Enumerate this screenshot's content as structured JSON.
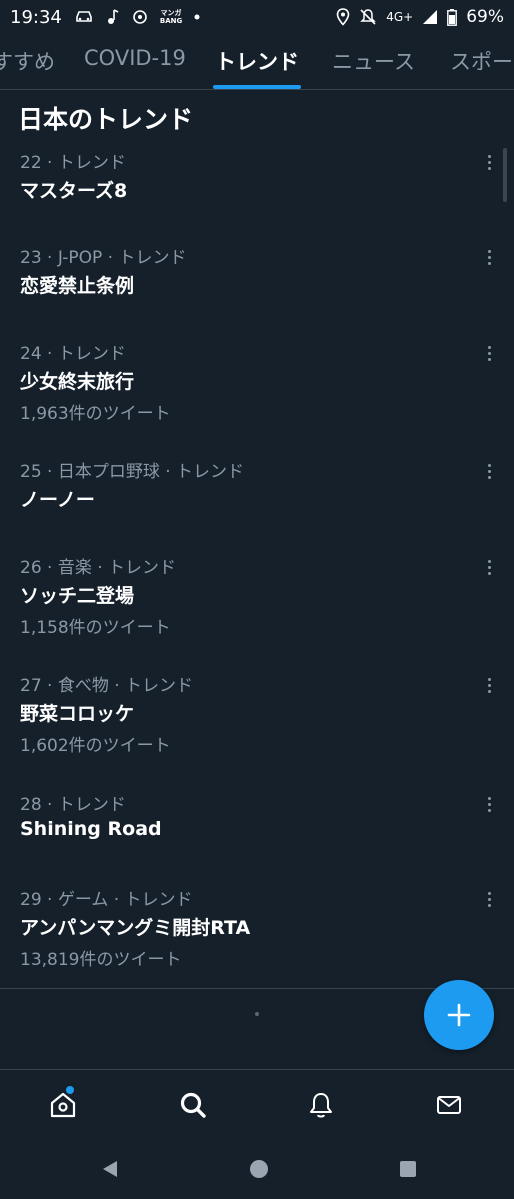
{
  "status_bar": {
    "time": "19:34",
    "network": "4G+",
    "battery": "69%",
    "icons": [
      "car-icon",
      "music-note-icon",
      "app-icon",
      "manga-bang-icon",
      "dot-icon",
      "location-icon",
      "mute-icon",
      "signal-icon",
      "battery-icon"
    ],
    "manga_line1": "マンガ",
    "manga_line2": "BANG"
  },
  "tabs": [
    {
      "label": "すすめ",
      "active": false
    },
    {
      "label": "COVID-19",
      "active": false
    },
    {
      "label": "トレンド",
      "active": true
    },
    {
      "label": "ニュース",
      "active": false
    },
    {
      "label": "スポー",
      "active": false
    }
  ],
  "section_title": "日本のトレンド",
  "trends": [
    {
      "meta": "22 · トレンド",
      "name": "マスターズ8",
      "count": ""
    },
    {
      "meta": "23 · J-POP · トレンド",
      "name": "恋愛禁止条例",
      "count": ""
    },
    {
      "meta": "24 · トレンド",
      "name": "少女終末旅行",
      "count": "1,963件のツイート"
    },
    {
      "meta": "25 · 日本プロ野球 · トレンド",
      "name": "ノーノー",
      "count": ""
    },
    {
      "meta": "26 · 音楽 · トレンド",
      "name": "ソッチ二登場",
      "count": "1,158件のツイート"
    },
    {
      "meta": "27 · 食べ物 · トレンド",
      "name": "野菜コロッケ",
      "count": "1,602件のツイート"
    },
    {
      "meta": "28 · トレンド",
      "name": "Shining Road",
      "count": ""
    },
    {
      "meta": "29 · ゲーム · トレンド",
      "name": "アンパンマングミ開封RTA",
      "count": "13,819件のツイート"
    }
  ],
  "fab": {
    "icon": "plus-icon"
  },
  "bottom_nav": {
    "items": [
      "home-icon",
      "search-icon",
      "bell-icon",
      "mail-icon"
    ],
    "home_has_notification": true
  },
  "system_nav": {
    "items": [
      "back-icon",
      "home-circle-icon",
      "recents-icon"
    ]
  },
  "colors": {
    "background": "#15202b",
    "accent": "#1d9bf0",
    "secondary_text": "#8b98a5",
    "divider": "#38444d"
  }
}
